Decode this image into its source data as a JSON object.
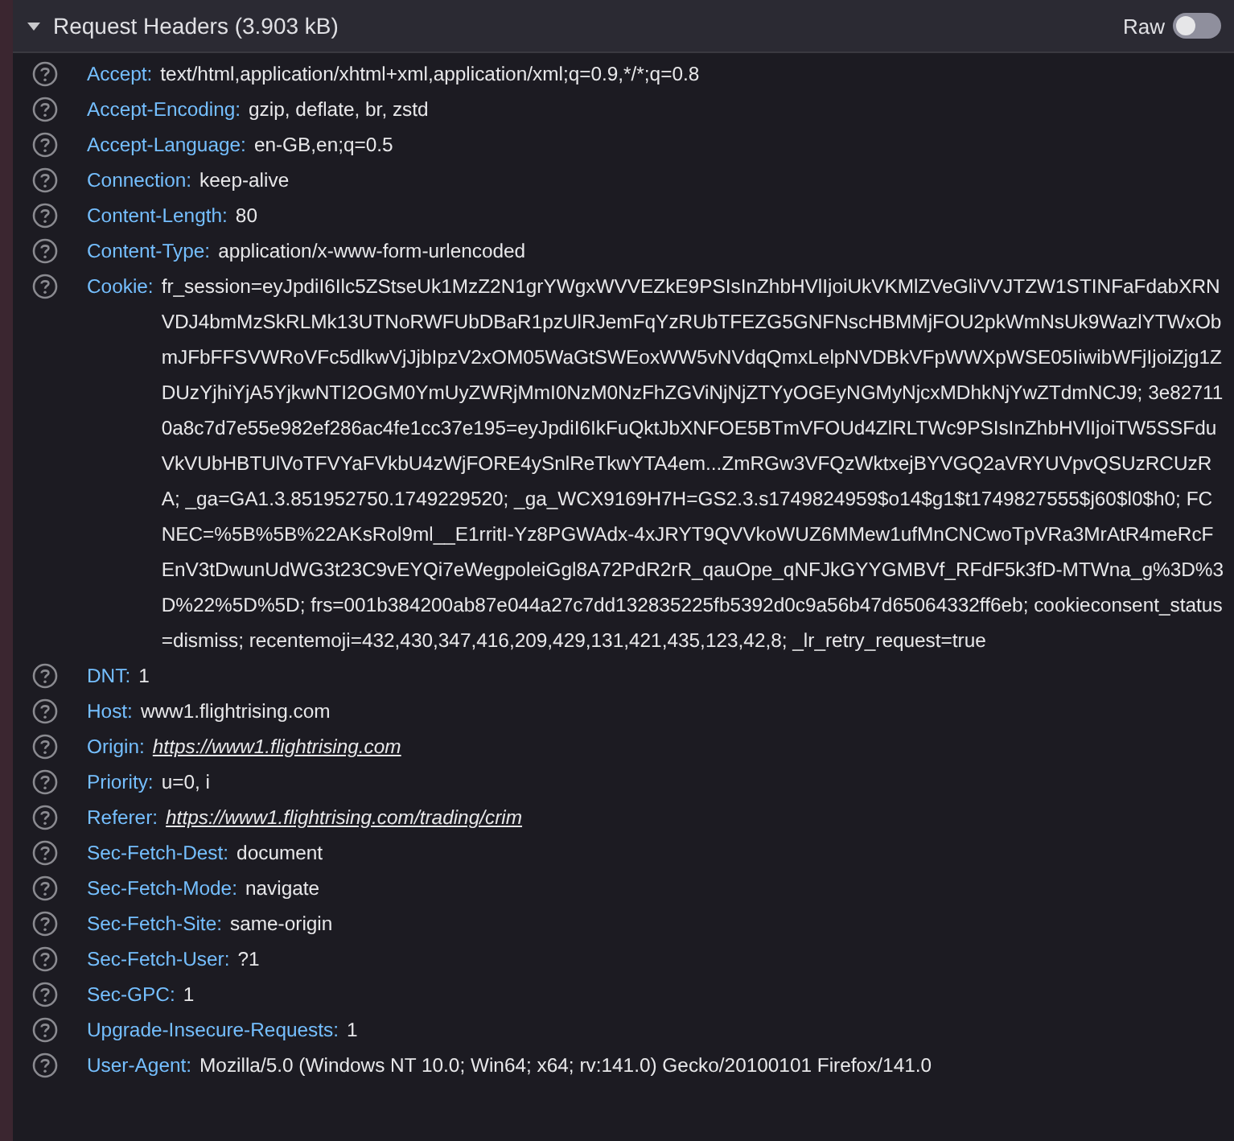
{
  "section": {
    "title": "Request Headers (3.903 kB)",
    "expanded": true,
    "raw_toggle": {
      "label": "Raw",
      "on": false
    }
  },
  "headers": [
    {
      "name": "Accept:",
      "value": "text/html,application/xhtml+xml,application/xml;q=0.9,*/*;q=0.8",
      "kind": "text"
    },
    {
      "name": "Accept-Encoding:",
      "value": "gzip, deflate, br, zstd",
      "kind": "text"
    },
    {
      "name": "Accept-Language:",
      "value": "en-GB,en;q=0.5",
      "kind": "text"
    },
    {
      "name": "Connection:",
      "value": "keep-alive",
      "kind": "text"
    },
    {
      "name": "Content-Length:",
      "value": "80",
      "kind": "text"
    },
    {
      "name": "Content-Type:",
      "value": "application/x-www-form-urlencoded",
      "kind": "text"
    },
    {
      "name": "Cookie:",
      "value": "fr_session=eyJpdiI6Ilc5ZStseUk1MzZ2N1grYWgxWVVEZkE9PSIsInZhbHVlIjoiUkVKMlZVeGliVVJTZW1STINFaFdabXRNVDJ4bmMzSkRLMk13UTNoRWFUbDBaR1pzUlRJemFqYzRUbTFEZG5GNFNscHBMMjFOU2pkWmNsUk9WazlYTWxObmJFbFFSVWRoVFc5dlkwVjJjbIpzV2xOM05WaGtSWEoxWW5vNVdqQmxLelpNVDBkVFpWWXpWSE05IiwibWFjIjoiZjg1ZDUzYjhiYjA5YjkwNTI2OGM0YmUyZWRjMmI0NzM0NzFhZGViNjNjZTYyOGEyNGMyNjcxMDhkNjYwZTdmNCJ9; 3e827110a8c7d7e55e982ef286ac4fe1cc37e195=eyJpdiI6IkFuQktJbXNFOE5BTmVFOUd4ZlRLTWc9PSIsInZhbHVlIjoiTW5SSFduVkVUbHBTUlVoTFVYaFVkbU4zWjFORE4ySnlReTkwYTA4em...ZmRGw3VFQzWktxejBYVGQ2aVRYUVpvQSUzRCUzRA; _ga=GA1.3.851952750.1749229520; _ga_WCX9169H7H=GS2.3.s1749824959$o14$g1$t1749827555$j60$l0$h0; FCNEC=%5B%5B%22AKsRol9ml__E1rritI-Yz8PGWAdx-4xJRYT9QVVkoWUZ6MMew1ufMnCNCwoTpVRa3MrAtR4meRcFEnV3tDwunUdWG3t23C9vEYQi7eWegpoleiGgl8A72PdR2rR_qauOpe_qNFJkGYYGMBVf_RFdF5k3fD-MTWna_g%3D%3D%22%5D%5D; frs=001b384200ab87e044a27c7dd132835225fb5392d0c9a56b47d65064332ff6eb; cookieconsent_status=dismiss; recentemoji=432,430,347,416,209,429,131,421,435,123,42,8; _lr_retry_request=true",
      "kind": "text"
    },
    {
      "name": "DNT:",
      "value": "1",
      "kind": "text"
    },
    {
      "name": "Host:",
      "value": "www1.flightrising.com",
      "kind": "text"
    },
    {
      "name": "Origin:",
      "value": "https://www1.flightrising.com",
      "kind": "link"
    },
    {
      "name": "Priority:",
      "value": "u=0, i",
      "kind": "text"
    },
    {
      "name": "Referer:",
      "value": "https://www1.flightrising.com/trading/crim",
      "kind": "link"
    },
    {
      "name": "Sec-Fetch-Dest:",
      "value": "document",
      "kind": "text"
    },
    {
      "name": "Sec-Fetch-Mode:",
      "value": "navigate",
      "kind": "text"
    },
    {
      "name": "Sec-Fetch-Site:",
      "value": "same-origin",
      "kind": "text"
    },
    {
      "name": "Sec-Fetch-User:",
      "value": "?1",
      "kind": "text"
    },
    {
      "name": "Sec-GPC:",
      "value": "1",
      "kind": "text"
    },
    {
      "name": "Upgrade-Insecure-Requests:",
      "value": "1",
      "kind": "text"
    },
    {
      "name": "User-Agent:",
      "value": "Mozilla/5.0 (Windows NT 10.0; Win64; x64; rv:141.0) Gecko/20100101 Firefox/141.0",
      "kind": "text"
    }
  ]
}
